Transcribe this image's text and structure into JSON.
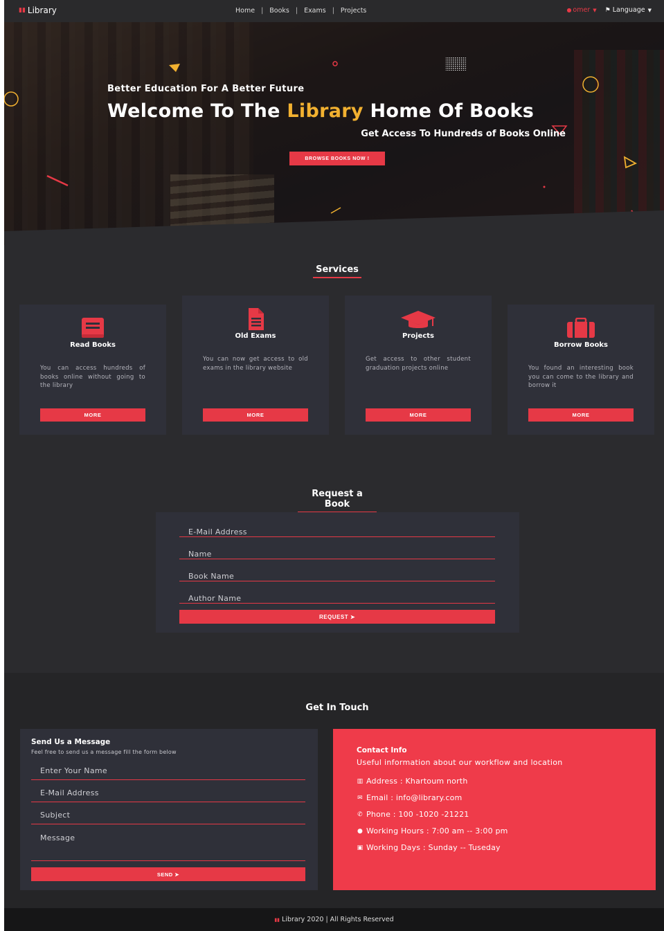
{
  "nav": {
    "brand_icon": "book-open-icon",
    "brand": "Library",
    "links": [
      "Home",
      "Books",
      "Exams",
      "Projects"
    ],
    "separator": "|",
    "user": "omer",
    "language": "Language"
  },
  "hero": {
    "kicker": "Better Education For A Better Future",
    "title_part1": "Welcome To The ",
    "title_accent": "Library",
    "title_part2": " Home Of Books",
    "subtitle": "Get Access To Hundreds of Books Online",
    "button": "BROWSE BOOKS NOW !"
  },
  "services": {
    "title": "Services",
    "cards": [
      {
        "icon": "book-icon",
        "title": "Read Books",
        "text": "You can access hundreds of books online without going to the library",
        "button": "MORE"
      },
      {
        "icon": "file-icon",
        "title": "Old Exams",
        "text": "You can now get access to old exams in the library website",
        "button": "MORE"
      },
      {
        "icon": "graduation-cap-icon",
        "title": "Projects",
        "text": "Get access to other student graduation projects online",
        "button": "MORE"
      },
      {
        "icon": "briefcase-icon",
        "title": "Borrow Books",
        "text": "You found an interesting book you can come to the library and borrow it",
        "button": "MORE"
      }
    ]
  },
  "request": {
    "title": "Request a Book",
    "fields": [
      "E-Mail Address",
      "Name",
      "Book Name",
      "Author Name"
    ],
    "button": "REQUEST ➤"
  },
  "contact": {
    "title": "Get In Touch",
    "form": {
      "heading": "Send Us a Message",
      "lead": "Feel free to send us a message fill the form below",
      "fields": [
        "Enter Your Name",
        "E-Mail Address",
        "Subject",
        "Message"
      ],
      "button": "SEND ➤"
    },
    "info": {
      "heading": "Contact Info",
      "lead": "Useful information about our workflow and location",
      "rows": [
        {
          "icon": "map-icon",
          "glyph": "▥",
          "text": "Address : Khartoum north"
        },
        {
          "icon": "envelope-icon",
          "glyph": "✉",
          "text": "Email : info@library.com"
        },
        {
          "icon": "phone-icon",
          "glyph": "✆",
          "text": "Phone : 100 -1020 -21221"
        },
        {
          "icon": "clock-icon",
          "glyph": "●",
          "text": "Working Hours : 7:00 am -- 3:00 pm"
        },
        {
          "icon": "calendar-icon",
          "glyph": "▣",
          "text": "Working Days : Sunday -- Tuseday"
        }
      ]
    }
  },
  "footer": {
    "text": "Library 2020 | All Rights Reserved"
  },
  "colors": {
    "accent": "#e63946",
    "highlight": "#f2b130",
    "background": "#2b2b2e",
    "card": "#2f3039"
  }
}
